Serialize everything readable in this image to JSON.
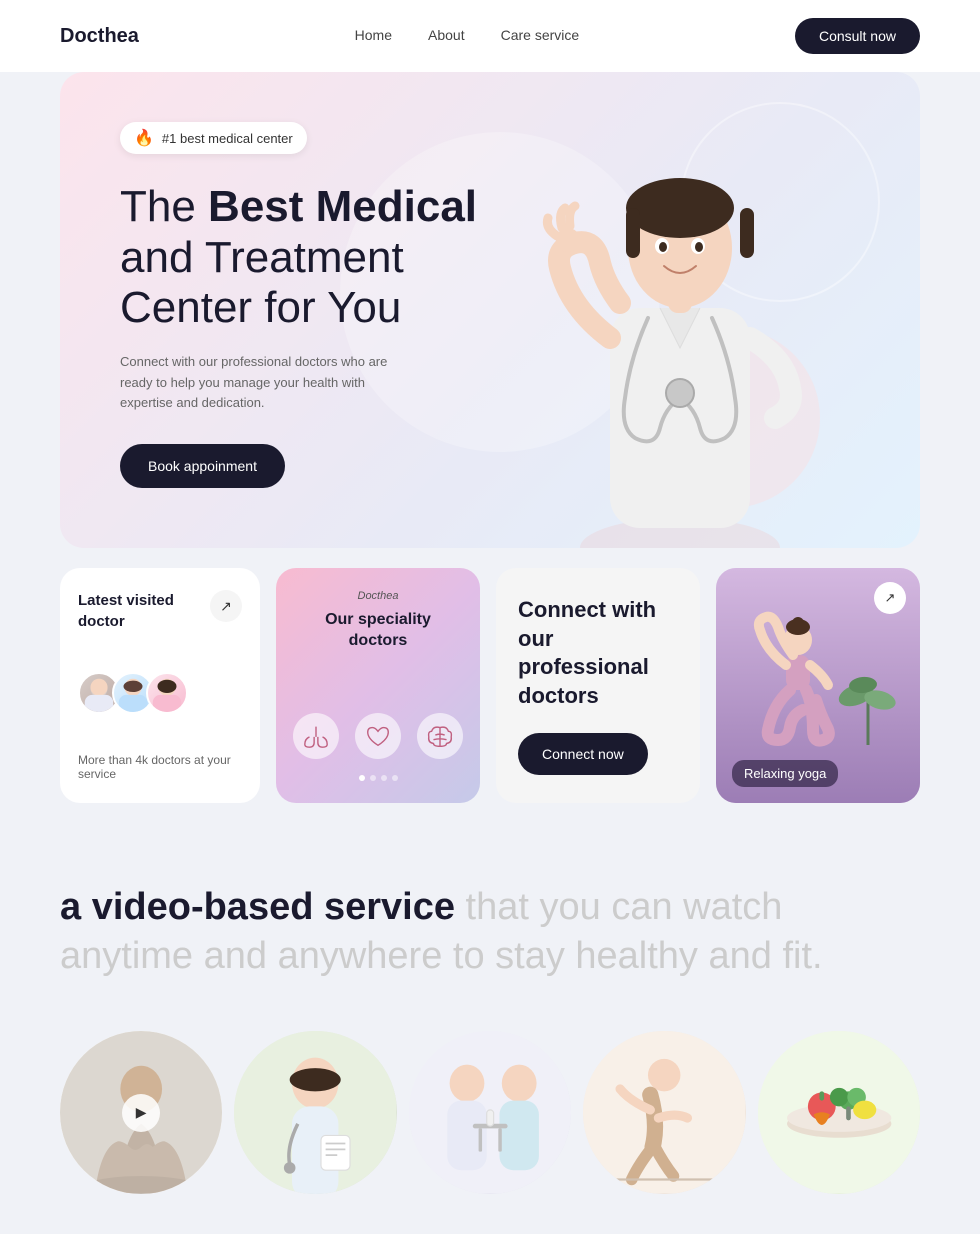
{
  "navbar": {
    "logo": "Docthea",
    "links": [
      {
        "label": "Home",
        "href": "#"
      },
      {
        "label": "About",
        "href": "#"
      },
      {
        "label": "Care service",
        "href": "#"
      }
    ],
    "cta_label": "Consult now"
  },
  "hero": {
    "badge": "#1 best medical center",
    "title_normal": "The ",
    "title_bold": "Best Medical",
    "title_rest": " and Treatment Center for You",
    "subtitle": "Connect with our professional doctors who are ready to help you manage your health with expertise and dedication.",
    "cta_label": "Book appoinment"
  },
  "cards": {
    "latest_doctor": {
      "title": "Latest visited doctor",
      "stat": "More than 4k doctors at your service",
      "arrow": "↗"
    },
    "speciality": {
      "tag": "Docthea",
      "title": "Our speciality doctors",
      "icons": [
        "🫁",
        "❤️",
        "🧠"
      ],
      "dots": [
        true,
        false,
        false,
        false
      ]
    },
    "connect": {
      "title": "Connect with our professional doctors",
      "btn_label": "Connect now"
    },
    "yoga": {
      "label": "Relaxing yoga",
      "arrow": "↗"
    }
  },
  "video_section": {
    "text_bold": "a video-based service",
    "text_normal": " that you can watch anytime and anywhere to stay healthy and fit."
  },
  "thumbnails": [
    {
      "id": 1,
      "label": "meditation"
    },
    {
      "id": 2,
      "label": "doctor"
    },
    {
      "id": 3,
      "label": "consultation"
    },
    {
      "id": 4,
      "label": "fitness"
    },
    {
      "id": 5,
      "label": "nutrition"
    }
  ]
}
